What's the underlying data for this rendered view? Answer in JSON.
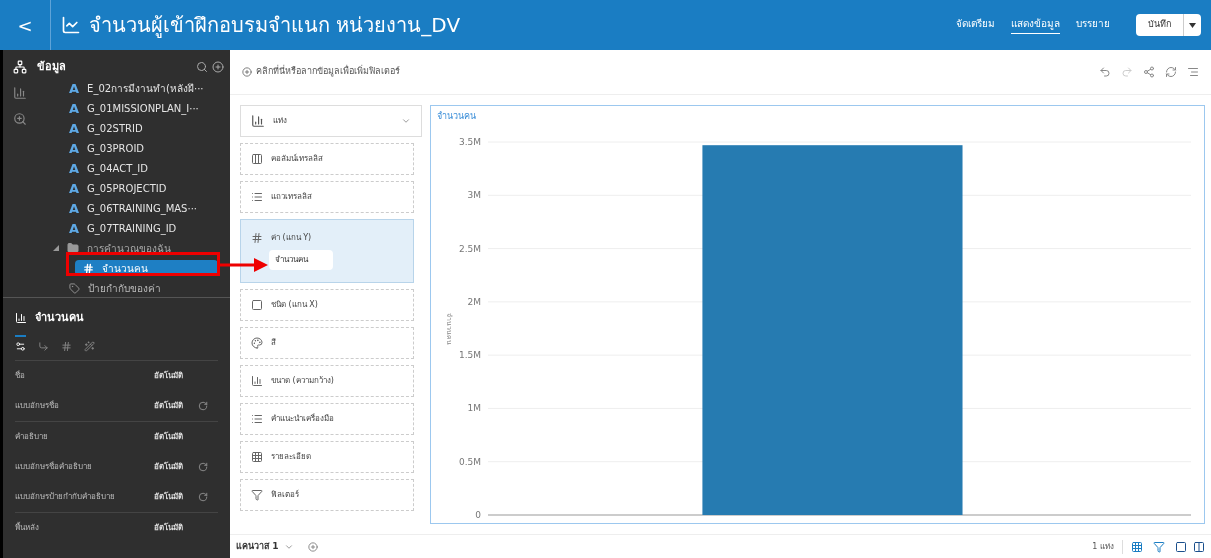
{
  "top_bar": {
    "back": "<",
    "title": "จำนวนผู้เข้าฝึกอบรมจำแนก หน่วยงาน_DV",
    "tabs": [
      {
        "label": "จัดเตรียม",
        "selected": false
      },
      {
        "label": "แสดงข้อมูล",
        "selected": true
      },
      {
        "label": "บรรยาย",
        "selected": false
      }
    ],
    "save": "บันทึก"
  },
  "data_panel": {
    "title": "ข้อมูล",
    "items": [
      {
        "kind": "attribute",
        "icon": "A",
        "label": "E_02การมีงานทำ(หลังฝึ···"
      },
      {
        "kind": "attribute",
        "icon": "A",
        "label": "G_01MISSIONPLAN_I···"
      },
      {
        "kind": "attribute",
        "icon": "A",
        "label": "G_02STRID"
      },
      {
        "kind": "attribute",
        "icon": "A",
        "label": "G_03PROID"
      },
      {
        "kind": "attribute",
        "icon": "A",
        "label": "G_04ACT_ID"
      },
      {
        "kind": "attribute",
        "icon": "A",
        "label": "G_05PROJECTID"
      },
      {
        "kind": "attribute",
        "icon": "A",
        "label": "G_06TRAINING_MAS···"
      },
      {
        "kind": "attribute",
        "icon": "A",
        "label": "G_07TRAINING_ID"
      },
      {
        "kind": "folder",
        "label": "การคำนวณของฉัน",
        "expanded": true,
        "selected": false,
        "children": [
          {
            "kind": "measure",
            "label": "จำนวนคน",
            "selected": true
          }
        ]
      },
      {
        "kind": "tag",
        "label": "ป้ายกำกับของค่า"
      }
    ]
  },
  "properties": {
    "title": "จำนวนคน",
    "tabs": [
      {
        "selected": true
      },
      {
        "selected": false
      },
      {
        "selected": false
      },
      {
        "selected": false
      }
    ],
    "sections": [
      {
        "rows": [
          {
            "label": "ชื่อ",
            "value": "อัตโนมัติ",
            "reset": false
          },
          {
            "label": "แบบอักษรชื่อ",
            "value": "อัตโนมัติ",
            "reset": true
          }
        ]
      },
      {
        "rows": [
          {
            "label": "คำอธิบาย",
            "value": "อัตโนมัติ",
            "reset": false
          },
          {
            "label": "แบบอักษรชื่อคำอธิบาย",
            "value": "อัตโนมัติ",
            "reset": true
          },
          {
            "label": "แบบอักษรป้ายกำกับคำอธิบาย",
            "value": "อัตโนมัติ",
            "reset": true
          }
        ]
      },
      {
        "rows": [
          {
            "label": "พื้นหลัง",
            "value": "อัตโนมัติ",
            "reset": false
          }
        ]
      }
    ]
  },
  "filter_bar": {
    "prompt": "คลิกที่นี่หรือลากข้อมูลเพื่อเพิ่มฟิลเตอร์"
  },
  "grammar": {
    "chart_type": "แท่ง",
    "zones": [
      {
        "kind": "columns",
        "label": "คอลัมน์เทรลลิส",
        "highlighted": false
      },
      {
        "kind": "rows",
        "label": "แถวเทรลลิส",
        "highlighted": false
      },
      {
        "kind": "values",
        "label": "ค่า (แกน Y)",
        "highlighted": true,
        "item": "จำนวนคน"
      },
      {
        "kind": "category",
        "label": "ชนิด (แกน X)",
        "highlighted": false
      },
      {
        "kind": "color",
        "label": "สี",
        "highlighted": false
      },
      {
        "kind": "size",
        "label": "ขนาด (ความกว้าง)",
        "highlighted": false
      },
      {
        "kind": "tooltip",
        "label": "คำแนะนำเครื่องมือ",
        "highlighted": false
      },
      {
        "kind": "detail",
        "label": "รายละเอียด",
        "highlighted": false
      },
      {
        "kind": "filter",
        "label": "ฟิลเตอร์",
        "highlighted": false
      }
    ]
  },
  "chart": {
    "title": "จำนวนคน",
    "chart_data": {
      "type": "bar",
      "ylabel": "จำนวนคน",
      "grid": true,
      "ylim": [
        0,
        3500000
      ],
      "yticks": [
        {
          "value": 0,
          "label": "0"
        },
        {
          "value": 500000,
          "label": "0.5M"
        },
        {
          "value": 1000000,
          "label": "1M"
        },
        {
          "value": 1500000,
          "label": "1.5M"
        },
        {
          "value": 2000000,
          "label": "2M"
        },
        {
          "value": 2500000,
          "label": "2.5M"
        },
        {
          "value": 3000000,
          "label": "3M"
        },
        {
          "value": 3500000,
          "label": "3.5M"
        }
      ],
      "series": [
        {
          "color": "#267bb1",
          "values": [
            3470000
          ]
        }
      ]
    }
  },
  "bottom_bar": {
    "canvas_tab": "แคนวาส 1",
    "status": "1 แท่ง"
  }
}
